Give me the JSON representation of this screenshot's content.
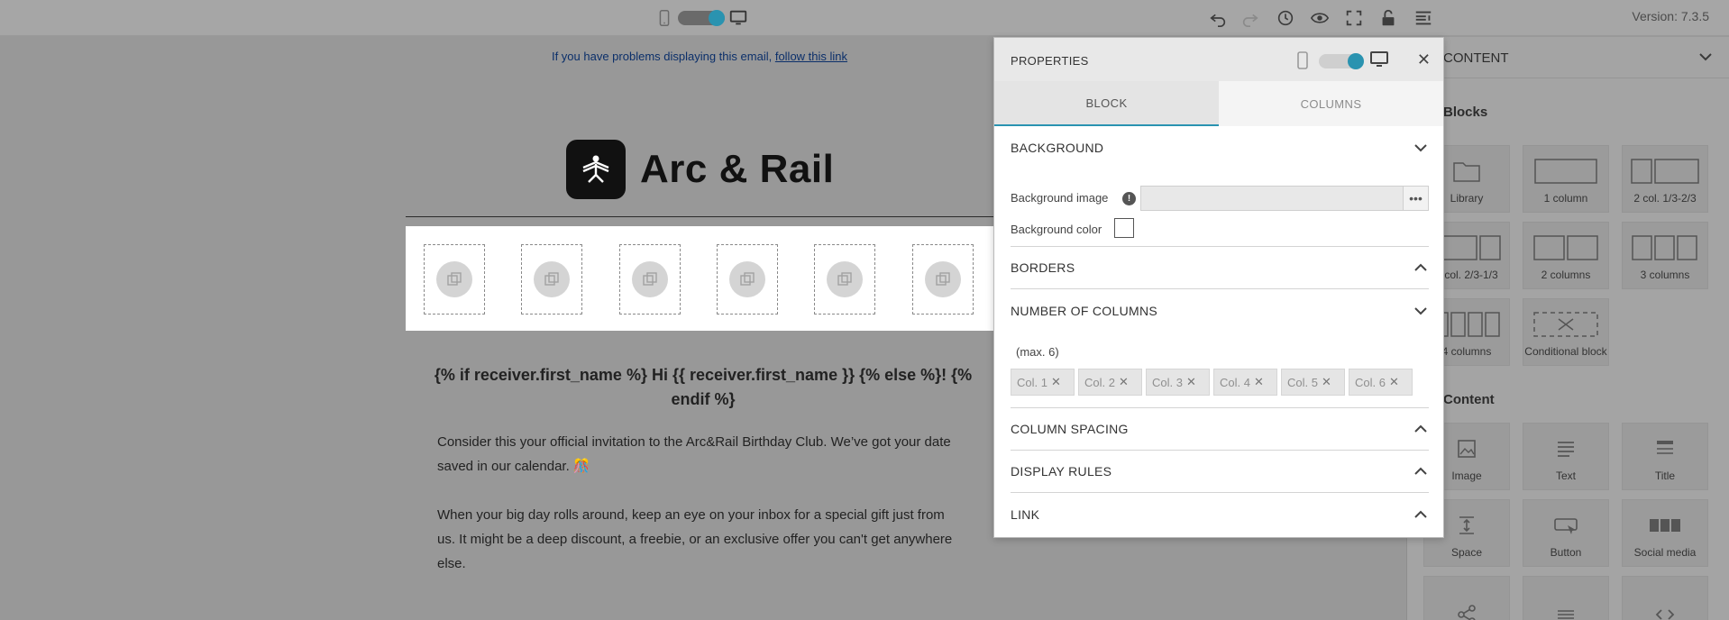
{
  "toolbar": {
    "version": "Version: 7.3.5",
    "icons": [
      "mobile-icon",
      "desktop-icon",
      "undo-icon",
      "redo-icon",
      "history-icon",
      "preview-icon",
      "fullscreen-icon",
      "unlock-icon",
      "sidebar-toggle-icon"
    ]
  },
  "email": {
    "preheader_text": "If you have problems displaying this email,",
    "preheader_link": "follow this link",
    "brand_name": "Arc & Rail",
    "greeting": "{% if receiver.first_name %} Hi {{ receiver.first_name }} {% else %}! {% endif %}",
    "paragraph1": "Consider this your official invitation to the Arc&Rail Birthday Club. We’ve got your date saved in our calendar. 🎊",
    "paragraph2": "When your big day rolls around, keep an eye on your inbox for a special gift just from us. It might be a deep discount, a freebie, or an exclusive offer you can't get anywhere else."
  },
  "sidebar": {
    "title": "CONTENT",
    "section_blocks": "Blocks",
    "section_content": "Content",
    "blocks": [
      {
        "label": "Library",
        "icon": "folder-icon"
      },
      {
        "label": "1 column",
        "icon": "one-column-icon"
      },
      {
        "label": "2 col. 1/3-2/3",
        "icon": "two-col-1-3-icon"
      },
      {
        "label": "2 col. 2/3-1/3",
        "icon": "two-col-2-3-icon"
      },
      {
        "label": "2 columns",
        "icon": "two-columns-icon"
      },
      {
        "label": "3 columns",
        "icon": "three-columns-icon"
      },
      {
        "label": "4 columns",
        "icon": "four-columns-icon"
      },
      {
        "label": "Conditional block",
        "icon": "conditional-block-icon"
      }
    ],
    "content": [
      {
        "label": "Image",
        "icon": "image-icon"
      },
      {
        "label": "Text",
        "icon": "text-icon"
      },
      {
        "label": "Title",
        "icon": "title-icon"
      },
      {
        "label": "Space",
        "icon": "space-icon"
      },
      {
        "label": "Button",
        "icon": "button-icon"
      },
      {
        "label": "Social media",
        "icon": "social-media-icon"
      },
      {
        "label": "",
        "icon": "share-icon"
      },
      {
        "label": "",
        "icon": "divider-icon"
      },
      {
        "label": "",
        "icon": "code-icon"
      }
    ]
  },
  "panel": {
    "title": "PROPERTIES",
    "tabs": [
      "BLOCK",
      "COLUMNS"
    ],
    "sections": {
      "background": "BACKGROUND",
      "borders": "BORDERS",
      "number_of_columns": "NUMBER OF COLUMNS",
      "column_spacing": "COLUMN SPACING",
      "display_rules": "DISPLAY RULES",
      "link": "LINK"
    },
    "background_image_label": "Background image",
    "background_image_value": "",
    "background_color_label": "Background color",
    "background_color_value": "#ffffff",
    "max_columns": "(max. 6)",
    "columns": [
      "Col. 1",
      "Col. 2",
      "Col. 3",
      "Col. 4",
      "Col. 5",
      "Col. 6"
    ]
  },
  "colors": {
    "accent": "#2a93b0",
    "overlay": "#989898"
  }
}
